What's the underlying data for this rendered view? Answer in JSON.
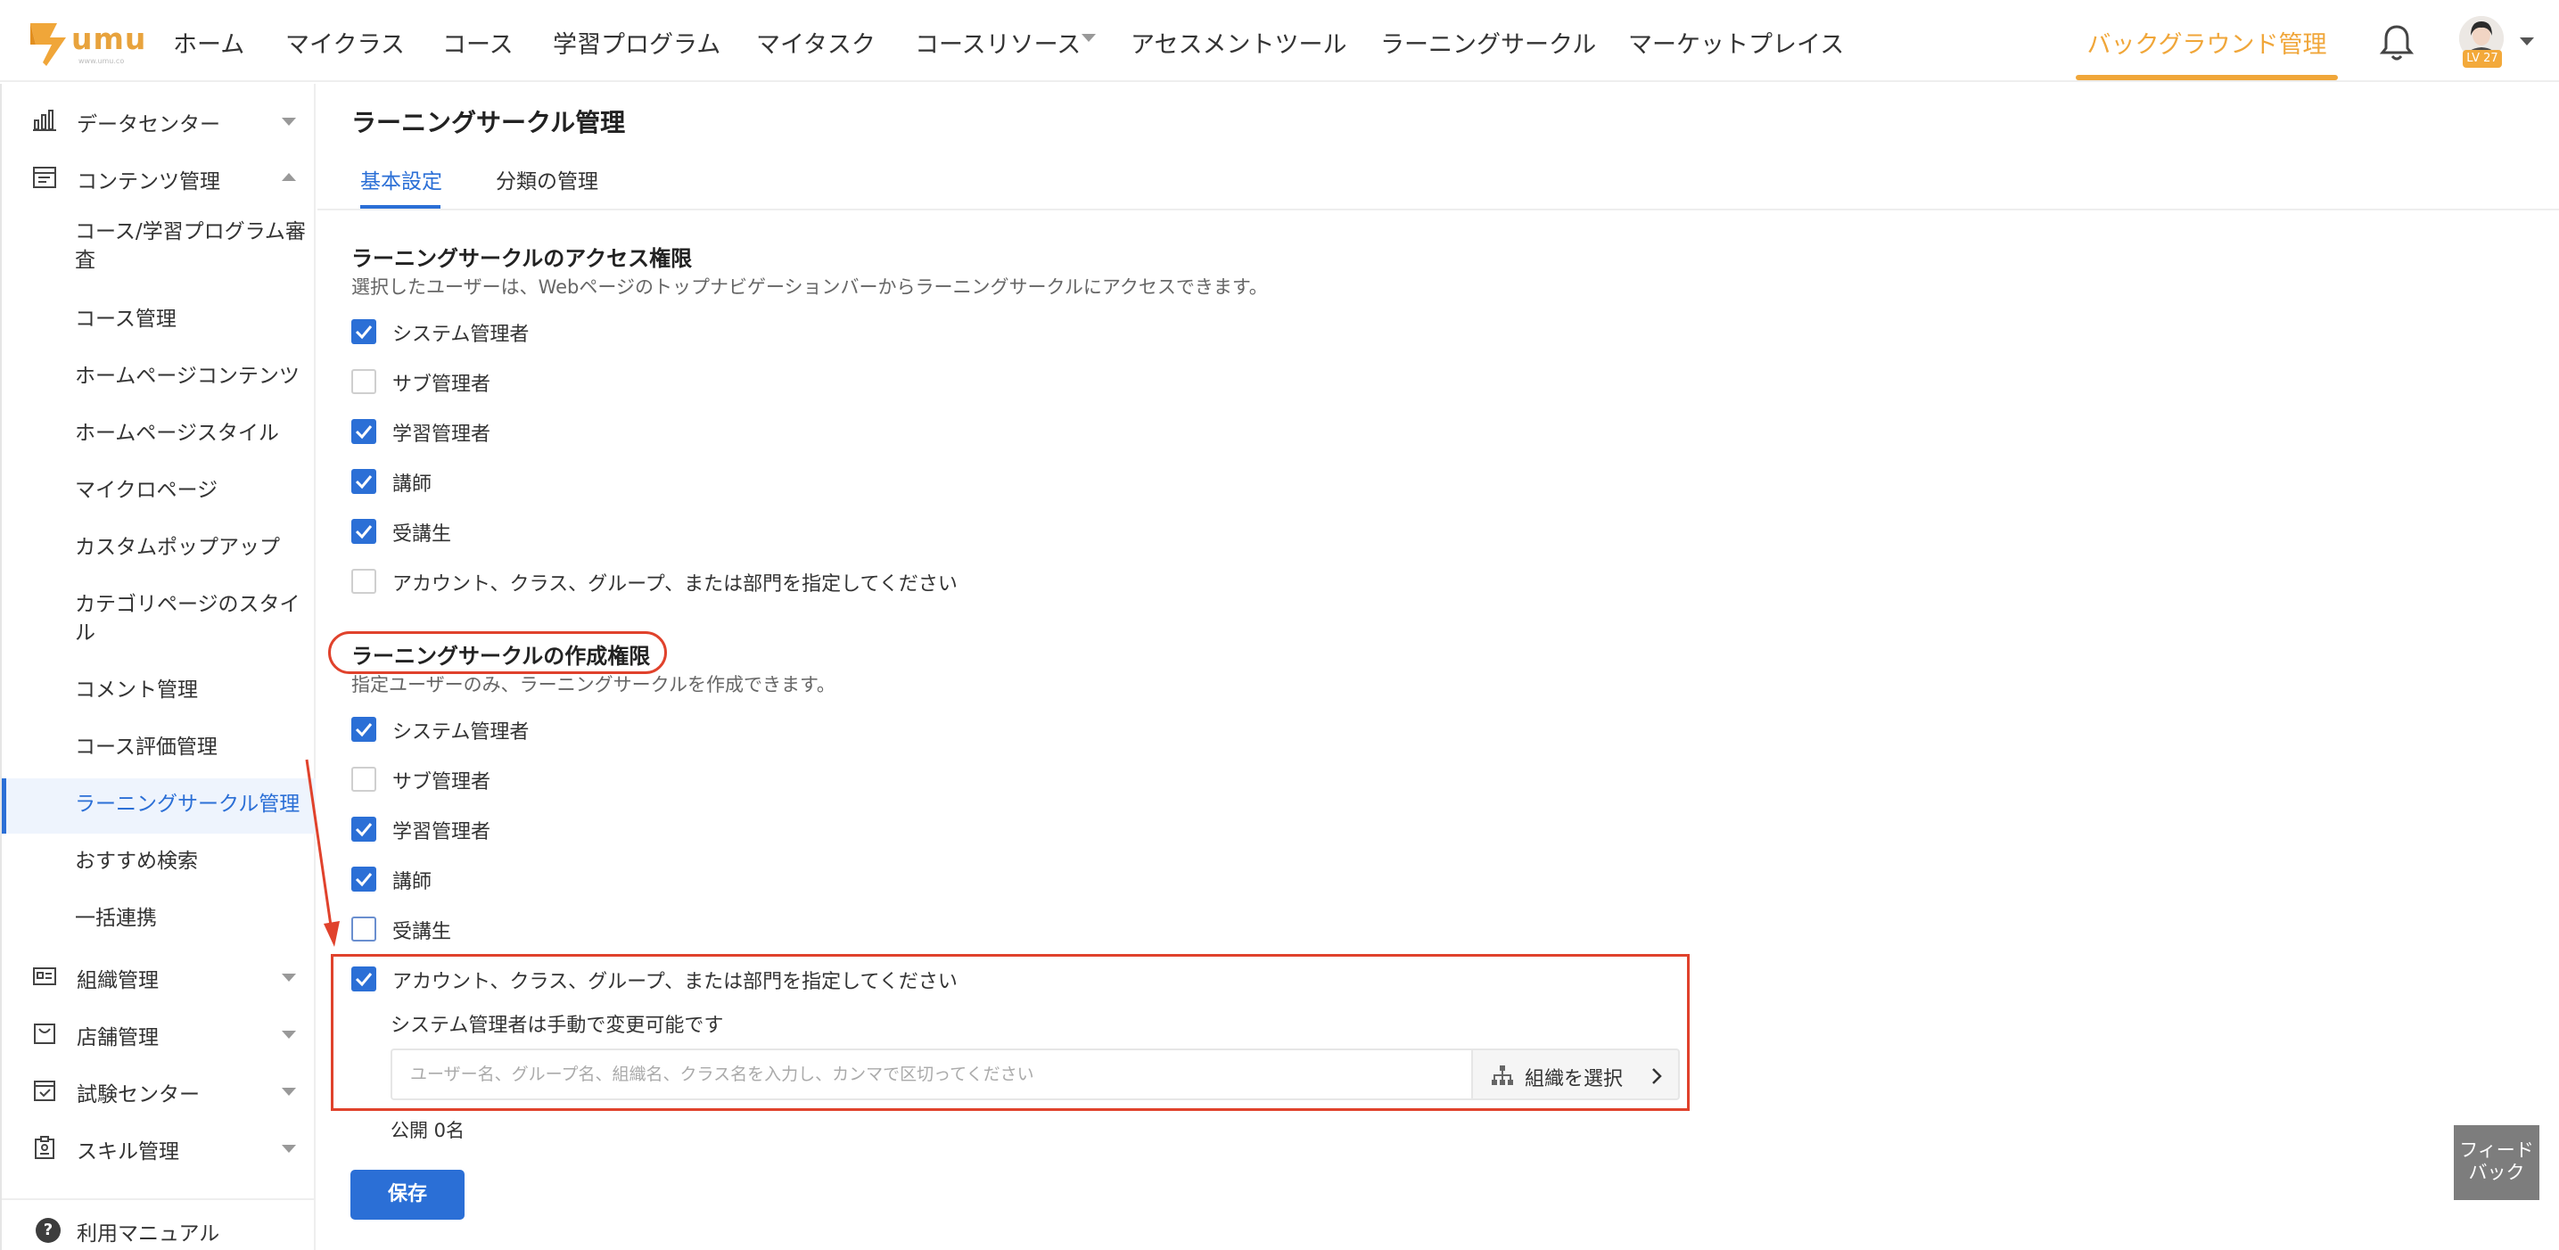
{
  "app": {
    "logo_text": "umu",
    "logo_url": "www.umu.co"
  },
  "nav": {
    "items": [
      "ホーム",
      "マイクラス",
      "コース",
      "学習プログラム",
      "マイタスク",
      "コースリソース",
      "アセスメントツール",
      "ラーニングサークル",
      "マーケットプレイス"
    ],
    "active": "バックグラウンド管理",
    "avatar_level": "LV 27"
  },
  "sidebar": {
    "groups": {
      "data_center": "データセンター",
      "content_mgmt": "コンテンツ管理",
      "org_mgmt": "組織管理",
      "store_mgmt": "店舗管理",
      "exam_center": "試験センター",
      "skill_mgmt": "スキル管理"
    },
    "sub_items": [
      "コース/学習プログラム審査",
      "コース管理",
      "ホームページコンテンツ",
      "ホームページスタイル",
      "マイクロページ",
      "カスタムポップアップ",
      "カテゴリページのスタイル",
      "コメント管理",
      "コース評価管理",
      "ラーニングサークル管理",
      "おすすめ検索",
      "一括連携"
    ],
    "help": "利用マニュアル"
  },
  "page": {
    "title": "ラーニングサークル管理",
    "tabs": [
      "基本設定",
      "分類の管理"
    ]
  },
  "access": {
    "title": "ラーニングサークルのアクセス権限",
    "desc": "選択したユーザーは、Webページのトップナビゲーションバーからラーニングサークルにアクセスできます。",
    "options": [
      {
        "label": "システム管理者",
        "checked": true
      },
      {
        "label": "サブ管理者",
        "checked": false
      },
      {
        "label": "学習管理者",
        "checked": true
      },
      {
        "label": "講師",
        "checked": true
      },
      {
        "label": "受講生",
        "checked": true
      },
      {
        "label": "アカウント、クラス、グループ、または部門を指定してください",
        "checked": false
      }
    ]
  },
  "create": {
    "title": "ラーニングサークルの作成権限",
    "desc": "指定ユーザーのみ、ラーニングサークルを作成できます。",
    "options": [
      {
        "label": "システム管理者",
        "checked": true
      },
      {
        "label": "サブ管理者",
        "checked": false
      },
      {
        "label": "学習管理者",
        "checked": true
      },
      {
        "label": "講師",
        "checked": true
      },
      {
        "label": "受講生",
        "checked": false
      },
      {
        "label": "アカウント、クラス、グループ、または部門を指定してください",
        "checked": true
      }
    ],
    "note": "システム管理者は手動で変更可能です",
    "input_placeholder": "ユーザー名、グループ名、組織名、クラス名を入力し、カンマで区切ってください",
    "org_button": "組織を選択",
    "public_count": "公開 0名"
  },
  "actions": {
    "save": "保存",
    "feedback": "フィードバック"
  },
  "colors": {
    "primary": "#2b6fd6",
    "accent": "#f0a639",
    "highlight": "#e0422c"
  }
}
